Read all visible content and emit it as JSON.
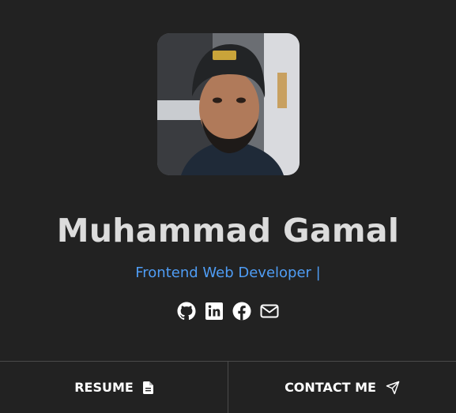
{
  "profile": {
    "name": "Muhammad Gamal",
    "role": "Frontend Web Developer |"
  },
  "socials": [
    {
      "icon": "github-icon"
    },
    {
      "icon": "linkedin-icon"
    },
    {
      "icon": "facebook-icon"
    },
    {
      "icon": "mail-icon"
    }
  ],
  "footer": {
    "resume_label": "RESUME",
    "resume_icon": "file-icon",
    "contact_label": "CONTACT ME",
    "contact_icon": "send-icon"
  },
  "colors": {
    "background": "#222222",
    "name": "#dcdcdc",
    "accent": "#4f9df5",
    "divider": "#4a4a4a"
  }
}
